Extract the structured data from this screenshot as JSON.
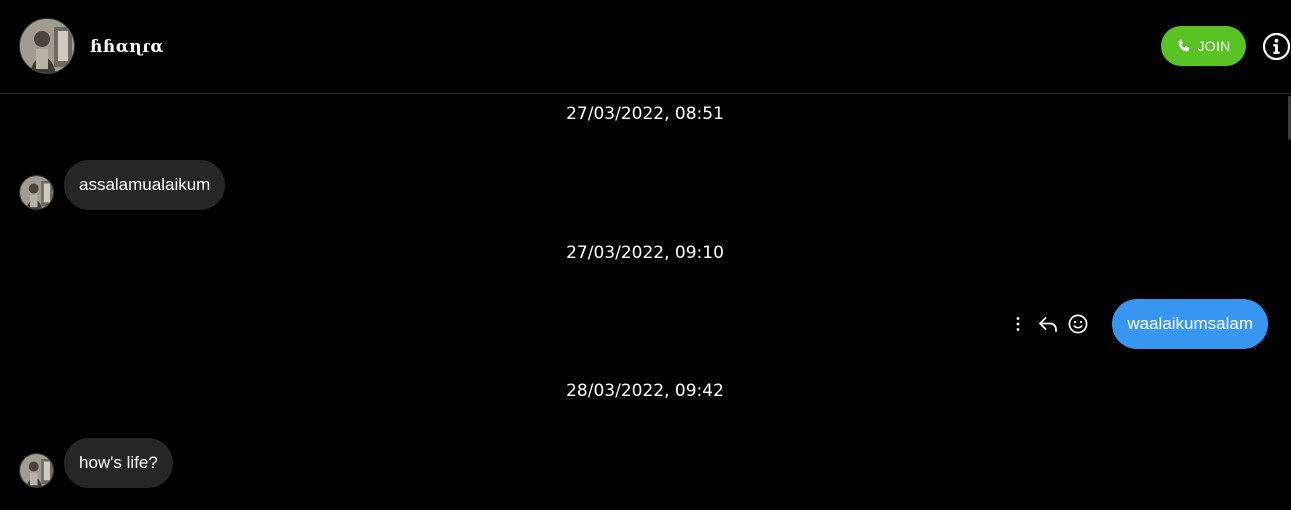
{
  "header": {
    "username": "ɦɦαɳɾα",
    "join_label": "JOIN",
    "join_color": "#58c322"
  },
  "thread": {
    "timestamps": [
      "27/03/2022, 08:51",
      "27/03/2022, 09:10",
      "28/03/2022, 09:42"
    ],
    "messages": [
      {
        "sender": "them",
        "text": "assalamualaikum"
      },
      {
        "sender": "me",
        "text": "waalaikumsalam",
        "color": "#3797f0"
      },
      {
        "sender": "them",
        "text": "how's life?"
      }
    ],
    "message_actions": [
      "more-options-icon",
      "reply-icon",
      "emoji-react-icon"
    ]
  },
  "colors": {
    "background": "#000000",
    "incoming_bubble": "#262626",
    "outgoing_bubble": "#3797f0"
  }
}
